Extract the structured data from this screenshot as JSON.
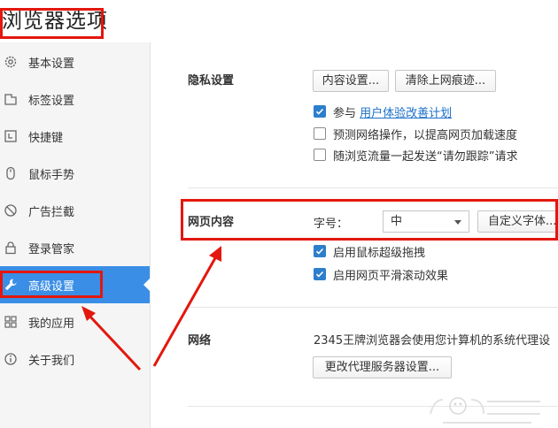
{
  "page": {
    "title": "浏览器选项"
  },
  "sidebar": {
    "items": [
      {
        "label": "基本设置",
        "icon": "gear-icon"
      },
      {
        "label": "标签设置",
        "icon": "tab-icon"
      },
      {
        "label": "快捷键",
        "icon": "keyboard-icon"
      },
      {
        "label": "鼠标手势",
        "icon": "mouse-icon"
      },
      {
        "label": "广告拦截",
        "icon": "block-icon"
      },
      {
        "label": "登录管家",
        "icon": "lock-icon"
      },
      {
        "label": "高级设置",
        "icon": "wrench-icon",
        "active": true
      },
      {
        "label": "我的应用",
        "icon": "apps-icon"
      },
      {
        "label": "关于我们",
        "icon": "info-icon"
      }
    ]
  },
  "privacy": {
    "title": "隐私设置",
    "content_settings_label": "内容设置...",
    "clear_traces_label": "清除上网痕迹...",
    "join_prefix": "参与",
    "join_link": "用户体验改善计划",
    "join_checked": true,
    "predict_label": "预测网络操作，以提高网页加载速度",
    "predict_checked": false,
    "dnt_label": "随浏览流量一起发送“请勿跟踪”请求",
    "dnt_checked": false
  },
  "web_content": {
    "title": "网页内容",
    "font_size_label": "字号：",
    "font_size_value": "中",
    "custom_font_label": "自定义字体...",
    "drag_label": "启用鼠标超级拖拽",
    "drag_checked": true,
    "smooth_scroll_label": "启用网页平滑滚动效果",
    "smooth_scroll_checked": true
  },
  "network": {
    "title": "网络",
    "description": "2345王牌浏览器会使用您计算机的系统代理设",
    "proxy_button_label": "更改代理服务器设置..."
  },
  "colors": {
    "accent": "#3a8ee6",
    "annotation": "#e3170d",
    "link": "#1a6fc9",
    "checkbox": "#2d7ecb"
  }
}
